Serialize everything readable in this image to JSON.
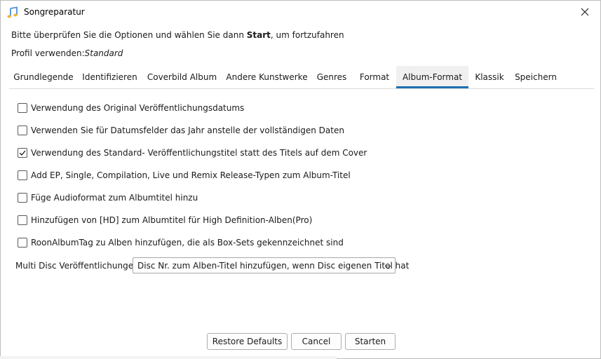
{
  "window": {
    "title": "Songreparatur"
  },
  "intro": {
    "before": "Bitte überprüfen Sie die Optionen und wählen Sie dann ",
    "bold": "Start",
    "after": ", um fortzufahren"
  },
  "profile": {
    "label": "Profil verwenden:",
    "value": "Standard"
  },
  "tabs": [
    {
      "label": "Grundlegende",
      "active": false
    },
    {
      "label": "Identifizieren",
      "active": false
    },
    {
      "label": "Coverbild Album",
      "active": false
    },
    {
      "label": "Andere Kunstwerke",
      "active": false
    },
    {
      "label": "Genres",
      "active": false
    },
    {
      "label": "Format",
      "active": false
    },
    {
      "label": "Album-Format",
      "active": true
    },
    {
      "label": "Klassik",
      "active": false
    },
    {
      "label": "Speichern",
      "active": false
    }
  ],
  "options": [
    {
      "label": "Verwendung des Original Veröffentlichungsdatums",
      "checked": false
    },
    {
      "label": "Verwenden Sie für Datumsfelder das Jahr anstelle der vollständigen Daten",
      "checked": false
    },
    {
      "label": "Verwendung des Standard- Veröffentlichungstitel statt des Titels auf dem Cover",
      "checked": true
    },
    {
      "label": "Add EP, Single, Compilation, Live und Remix Release-Typen zum Album-Titel",
      "checked": false
    },
    {
      "label": "Füge Audioformat zum Albumtitel hinzu",
      "checked": false
    },
    {
      "label": "Hinzufügen von [HD] zum Albumtitel für High Definition-Alben(Pro)",
      "checked": false
    },
    {
      "label": "RoonAlbumTag zu Alben hinzufügen, die als Box-Sets gekennzeichnet sind",
      "checked": false
    }
  ],
  "multidisc": {
    "label": "Multi Disc Veröffentlichungen:",
    "selected": "Disc Nr. zum Alben-Titel hinzufügen, wenn Disc eigenen Titel hat"
  },
  "buttons": {
    "restore": "Restore Defaults",
    "cancel": "Cancel",
    "start": "Starten"
  },
  "colors": {
    "accent": "#1f6fb4",
    "active_tab_bg": "#f0f0f0"
  }
}
